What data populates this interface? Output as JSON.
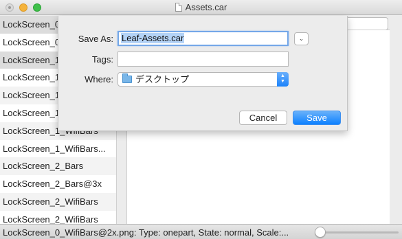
{
  "window": {
    "title": "Assets.car"
  },
  "sidebar": {
    "items": [
      {
        "label": "LockScreen_0_WifiBars@2x.png"
      },
      {
        "label": "LockScreen_0_WifiBars@3x.png"
      },
      {
        "label": "LockScreen_1_Bars"
      },
      {
        "label": "LockScreen_1_Bars@2x"
      },
      {
        "label": "LockScreen_1_Bars@3x"
      },
      {
        "label": "LockScreen_1_WifiBars"
      },
      {
        "label": "LockScreen_1_WifiBars"
      },
      {
        "label": "LockScreen_1_WifiBars..."
      },
      {
        "label": "LockScreen_2_Bars"
      },
      {
        "label": "LockScreen_2_Bars@3x"
      },
      {
        "label": "LockScreen_2_WifiBars"
      },
      {
        "label": "LockScreen_2_WifiBars"
      }
    ]
  },
  "save_sheet": {
    "save_as_label": "Save As:",
    "save_as_value": "Leaf-Assets.car",
    "tags_label": "Tags:",
    "tags_value": "",
    "where_label": "Where:",
    "where_value": "デスクトップ",
    "cancel_label": "Cancel",
    "save_label": "Save"
  },
  "statusbar": {
    "text": "LockScreen_0_WifiBars@2x.png: Type: onepart, State: normal, Scale:...",
    "zoom_slider_value": 0.0
  },
  "colors": {
    "accent": "#1a82fb",
    "selection": "#b4d3f7"
  }
}
